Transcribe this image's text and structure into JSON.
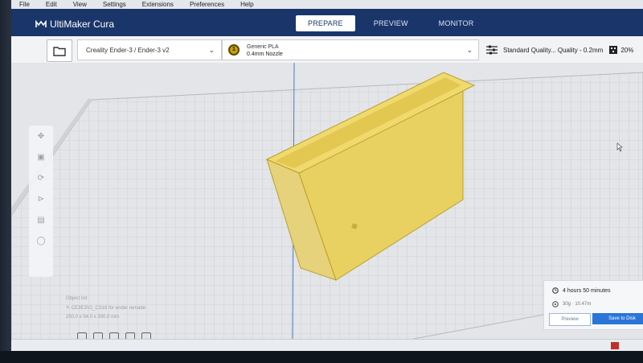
{
  "menubar": {
    "items": [
      "File",
      "Edit",
      "View",
      "Settings",
      "Extensions",
      "Preferences",
      "Help"
    ]
  },
  "header": {
    "app_title": "UltiMaker Cura",
    "stages": [
      {
        "label": "PREPARE",
        "active": true
      },
      {
        "label": "PREVIEW",
        "active": false
      },
      {
        "label": "MONITOR",
        "active": false
      }
    ]
  },
  "toolbar": {
    "open_icon": "folder-icon",
    "printer": "Creality Ender-3 / Ender-3 v2",
    "extruder_number": "1",
    "material": "Generic PLA",
    "nozzle": "0.4mm Nozzle",
    "quality": "Standard Quality... Quality - 0.2mm",
    "infill": "20%"
  },
  "side_tools": [
    "move-icon",
    "scale-icon",
    "rotate-icon",
    "mirror-icon",
    "per-model-settings-icon",
    "support-blocker-icon"
  ],
  "object_info": {
    "list_title": "Object list",
    "filename": "CE3E3V2_CS16 for ender remade",
    "dimensions": "250.0 x 54.0 x 300.0 mm"
  },
  "print_panel": {
    "time": "4 hours 50 minutes",
    "material": "30g · 10.47m",
    "preview_label": "Preview",
    "save_label": "Save to Disk"
  },
  "colors": {
    "header": "#19356a",
    "object": "#e8cf58",
    "accent": "#2a76d6"
  }
}
